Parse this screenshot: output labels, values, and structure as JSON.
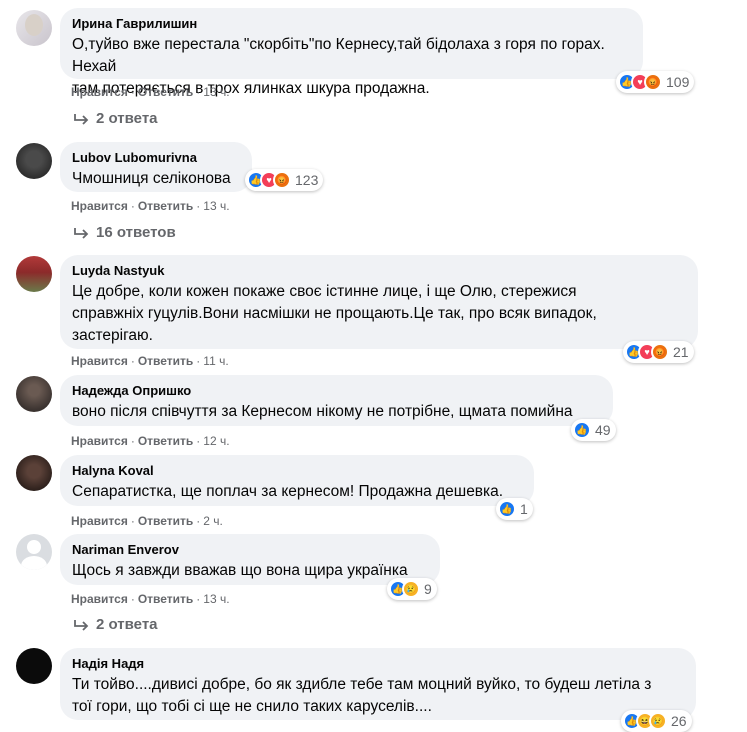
{
  "labels": {
    "like": "Нравится",
    "reply": "Ответить",
    "dot": "·"
  },
  "colors": {
    "like": "#1877f2",
    "love": "#f33e58",
    "angry": "#e9710f",
    "sad": "#f7b125",
    "bubble": "#f0f2f5"
  },
  "comments": [
    {
      "author": "Ирина Гаврилишин",
      "text": "О,туйво вже перестала \"скорбіть\"по Кернесу,тай бідолаха з горя по горах. Нехай\nтам потеряється в трох ялинках шкура продажна.",
      "time": "13 ч.",
      "reactions": [
        "like",
        "love",
        "angry"
      ],
      "reaction_count": "109",
      "replies": "2 ответа"
    },
    {
      "author": "Lubov Lubomurivna",
      "text": "Чмошниця селіконова",
      "time": "13 ч.",
      "reactions": [
        "like",
        "love",
        "angry"
      ],
      "reaction_count": "123",
      "replies": "16 ответов"
    },
    {
      "author": "Luyda Nastyuk",
      "text": "Це добре, коли кожен покаже своє істинне лице, і ще Олю, стережися\nсправжніх гуцулів.Вони насмішки не прощають.Це так, про всяк випадок,\nзастерігаю.",
      "time": "11 ч.",
      "reactions": [
        "like",
        "love",
        "angry"
      ],
      "reaction_count": "21"
    },
    {
      "author": "Надежда Опришко",
      "text": "воно після співчуття за Кернесом нікому не потрібне, щмата помийна",
      "time": "12 ч.",
      "reactions": [
        "like"
      ],
      "reaction_count": "49"
    },
    {
      "author": "Halyna Koval",
      "text": "Сепаратистка, ще поплач за кернесом! Продажна дешевка.",
      "time": "2 ч.",
      "reactions": [
        "like"
      ],
      "reaction_count": "1"
    },
    {
      "author": "Nariman Enverov",
      "text": "Щось я завжди вважав що вона щира українка",
      "time": "13 ч.",
      "reactions": [
        "like",
        "sad"
      ],
      "reaction_count": "9",
      "replies": "2 ответа"
    },
    {
      "author": "Надія Надя",
      "text": "Ти тойво....дивисі добре, бо як здибле тебе там моцний вуйко, то будеш летіла з\nтої гори, що тобі сі ще не снило таких каруселів....",
      "reactions": [
        "like",
        "haha",
        "sad"
      ],
      "reaction_count": "26"
    }
  ]
}
